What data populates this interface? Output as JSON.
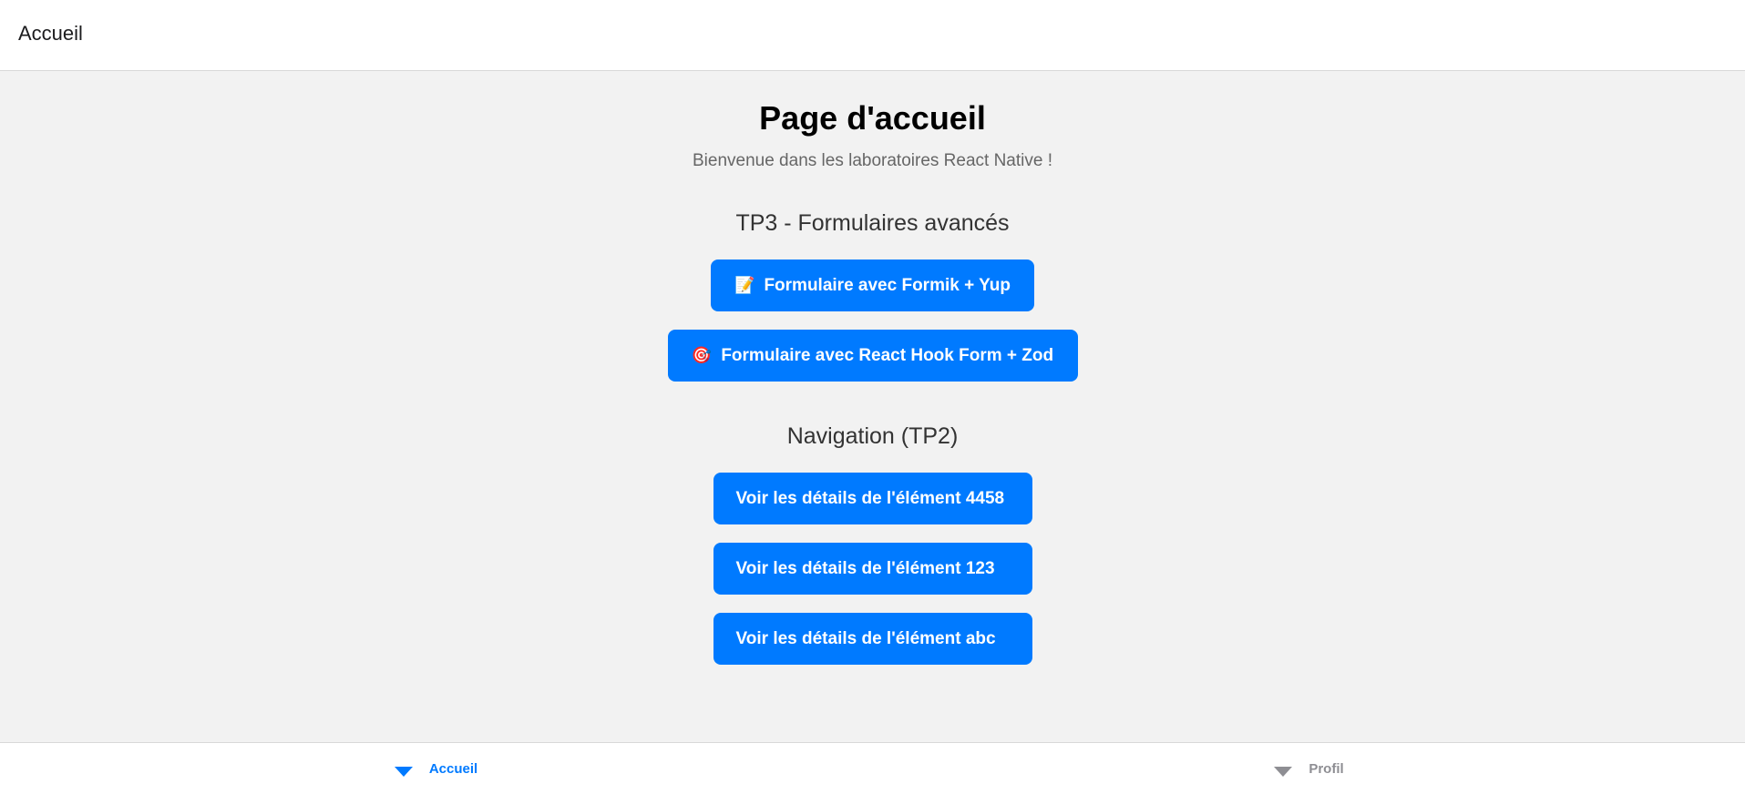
{
  "header": {
    "title": "Accueil"
  },
  "main": {
    "title": "Page d'accueil",
    "subtitle": "Bienvenue dans les laboratoires React Native !",
    "tp3_section": {
      "title": "TP3 - Formulaires avancés",
      "buttons": [
        {
          "icon": "memo-icon",
          "emoji": "📝",
          "label": "Formulaire avec Formik + Yup"
        },
        {
          "icon": "target-icon",
          "emoji": "🎯",
          "label": "Formulaire avec React Hook Form + Zod"
        }
      ]
    },
    "nav_section": {
      "title": "Navigation (TP2)",
      "buttons": [
        {
          "label": "Voir les détails de l'élément 4458"
        },
        {
          "label": "Voir les détails de l'élément 123"
        },
        {
          "label": "Voir les détails de l'élément abc"
        }
      ]
    }
  },
  "tabbar": {
    "tabs": [
      {
        "label": "Accueil",
        "icon": "caret-down-icon",
        "active": true
      },
      {
        "label": "Profil",
        "icon": "caret-down-icon",
        "active": false
      }
    ]
  },
  "colors": {
    "accent": "#007aff",
    "inactive": "#8e8e93",
    "background": "#f2f2f2"
  }
}
